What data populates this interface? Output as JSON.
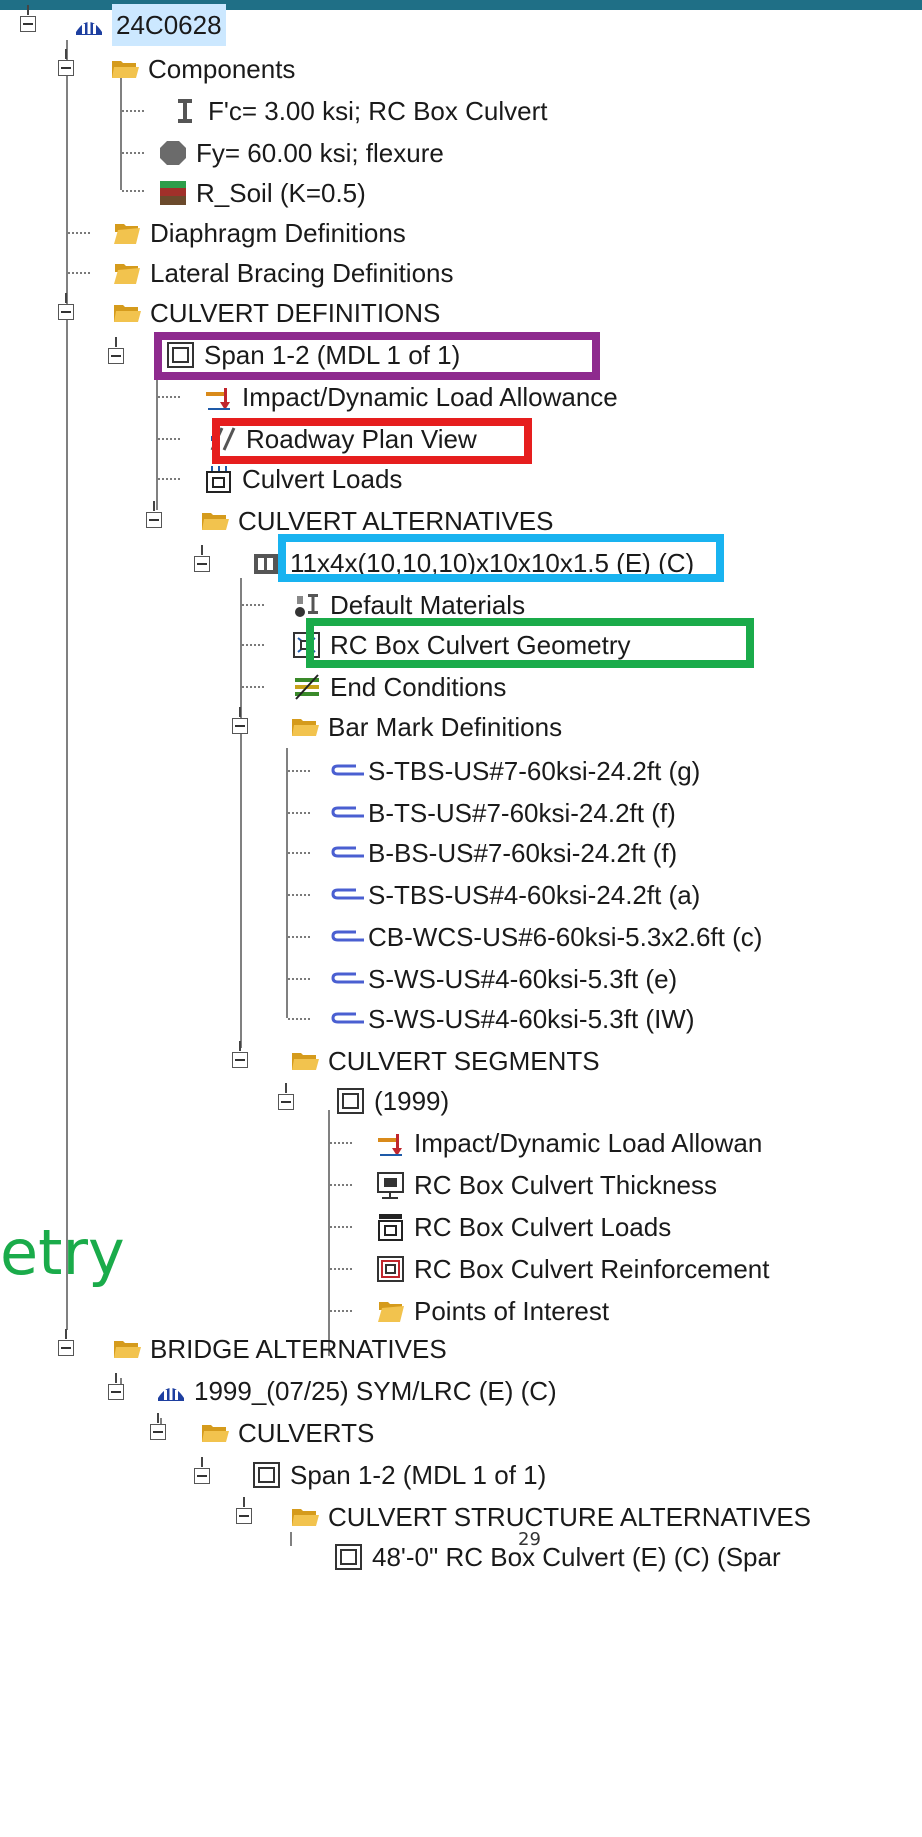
{
  "tree": {
    "root": {
      "label": "24C0628",
      "icon": "bridge-icon"
    },
    "components": {
      "label": "Components",
      "icon": "open-folder-icon",
      "items": [
        {
          "label": "F'c= 3.00 ksi; RC Box Culvert",
          "icon": "i-beam-icon"
        },
        {
          "label": "Fy= 60.00 ksi; flexure",
          "icon": "steel-octagon-icon"
        },
        {
          "label": "R_Soil (K=0.5)",
          "icon": "soil-layers-icon"
        }
      ]
    },
    "diaphragm_definitions": {
      "label": "Diaphragm Definitions",
      "icon": "folder-icon"
    },
    "lateral_bracing_definitions": {
      "label": "Lateral Bracing Definitions",
      "icon": "folder-icon"
    },
    "culvert_definitions": {
      "label": "CULVERT DEFINITIONS",
      "icon": "open-folder-icon",
      "span": {
        "label": "Span 1-2 (MDL 1 of 1)",
        "icon": "square-box-icon",
        "children": [
          {
            "label": "Impact/Dynamic Load Allowance",
            "icon": "impact-load-icon"
          },
          {
            "label": "Roadway Plan View",
            "icon": "plan-view-icon"
          },
          {
            "label": "Culvert Loads",
            "icon": "culvert-loads-icon"
          }
        ],
        "alternatives": {
          "label": "CULVERT ALTERNATIVES",
          "icon": "open-folder-icon",
          "alternative": {
            "label": "11x4x(10,10,10)x10x10x1.5 (E)  (C)",
            "icon": "box-culvert-icon",
            "children": [
              {
                "label": "Default Materials",
                "icon": "materials-icon"
              },
              {
                "label": "RC Box Culvert Geometry",
                "icon": "geometry-icon"
              },
              {
                "label": "End Conditions",
                "icon": "end-conditions-icon"
              }
            ],
            "bar_marks": {
              "label": "Bar Mark Definitions",
              "icon": "open-folder-icon",
              "items": [
                "S-TBS-US#7-60ksi-24.2ft (g)",
                "B-TS-US#7-60ksi-24.2ft (f)",
                "B-BS-US#7-60ksi-24.2ft (f)",
                "S-TBS-US#4-60ksi-24.2ft (a)",
                "CB-WCS-US#6-60ksi-5.3x2.6ft (c)",
                "S-WS-US#4-60ksi-5.3ft (e)",
                "S-WS-US#4-60ksi-5.3ft (IW)"
              ],
              "item_icon": "rebar-icon"
            },
            "segments": {
              "label": "CULVERT SEGMENTS",
              "icon": "open-folder-icon",
              "segment": {
                "label": "(1999)",
                "icon": "square-box-icon",
                "children": [
                  {
                    "label": "Impact/Dynamic Load Allowan",
                    "icon": "impact-load-icon"
                  },
                  {
                    "label": "RC Box Culvert Thickness",
                    "icon": "thickness-icon"
                  },
                  {
                    "label": "RC Box Culvert Loads",
                    "icon": "culvert-loads-icon"
                  },
                  {
                    "label": "RC Box Culvert Reinforcement",
                    "icon": "reinforcement-icon"
                  },
                  {
                    "label": "Points of Interest",
                    "icon": "folder-icon"
                  }
                ]
              }
            }
          }
        }
      }
    },
    "bridge_alternatives": {
      "label": "BRIDGE ALTERNATIVES",
      "icon": "open-folder-icon",
      "bridge": {
        "label": "1999_(07/25) SYM/LRC (E)  (C)",
        "icon": "bridge-icon",
        "culverts": {
          "label": "CULVERTS",
          "icon": "open-folder-icon",
          "span": {
            "label": "Span 1-2 (MDL 1 of 1)",
            "icon": "square-box-icon",
            "structure_alts": {
              "label": "CULVERT STRUCTURE ALTERNATIVES",
              "icon": "open-folder-icon",
              "item": {
                "label": "48'-0\" RC Box Culvert (E) (C)  (Spar",
                "icon": "square-box-icon"
              }
            }
          }
        }
      }
    }
  },
  "overlays": {
    "geometry_text": "etry",
    "page_number": "29",
    "highlight_colors": {
      "purple": "#8e2a8e",
      "red": "#e61e1e",
      "blue": "#19b3f0",
      "green": "#1aab4a"
    },
    "green_text_color": "#1aab4a"
  },
  "colors": {
    "folder": "#f2c34e",
    "folder_dark": "#d59b1c",
    "rebar": "#4a5fd1",
    "selection": "#cce8ff"
  }
}
